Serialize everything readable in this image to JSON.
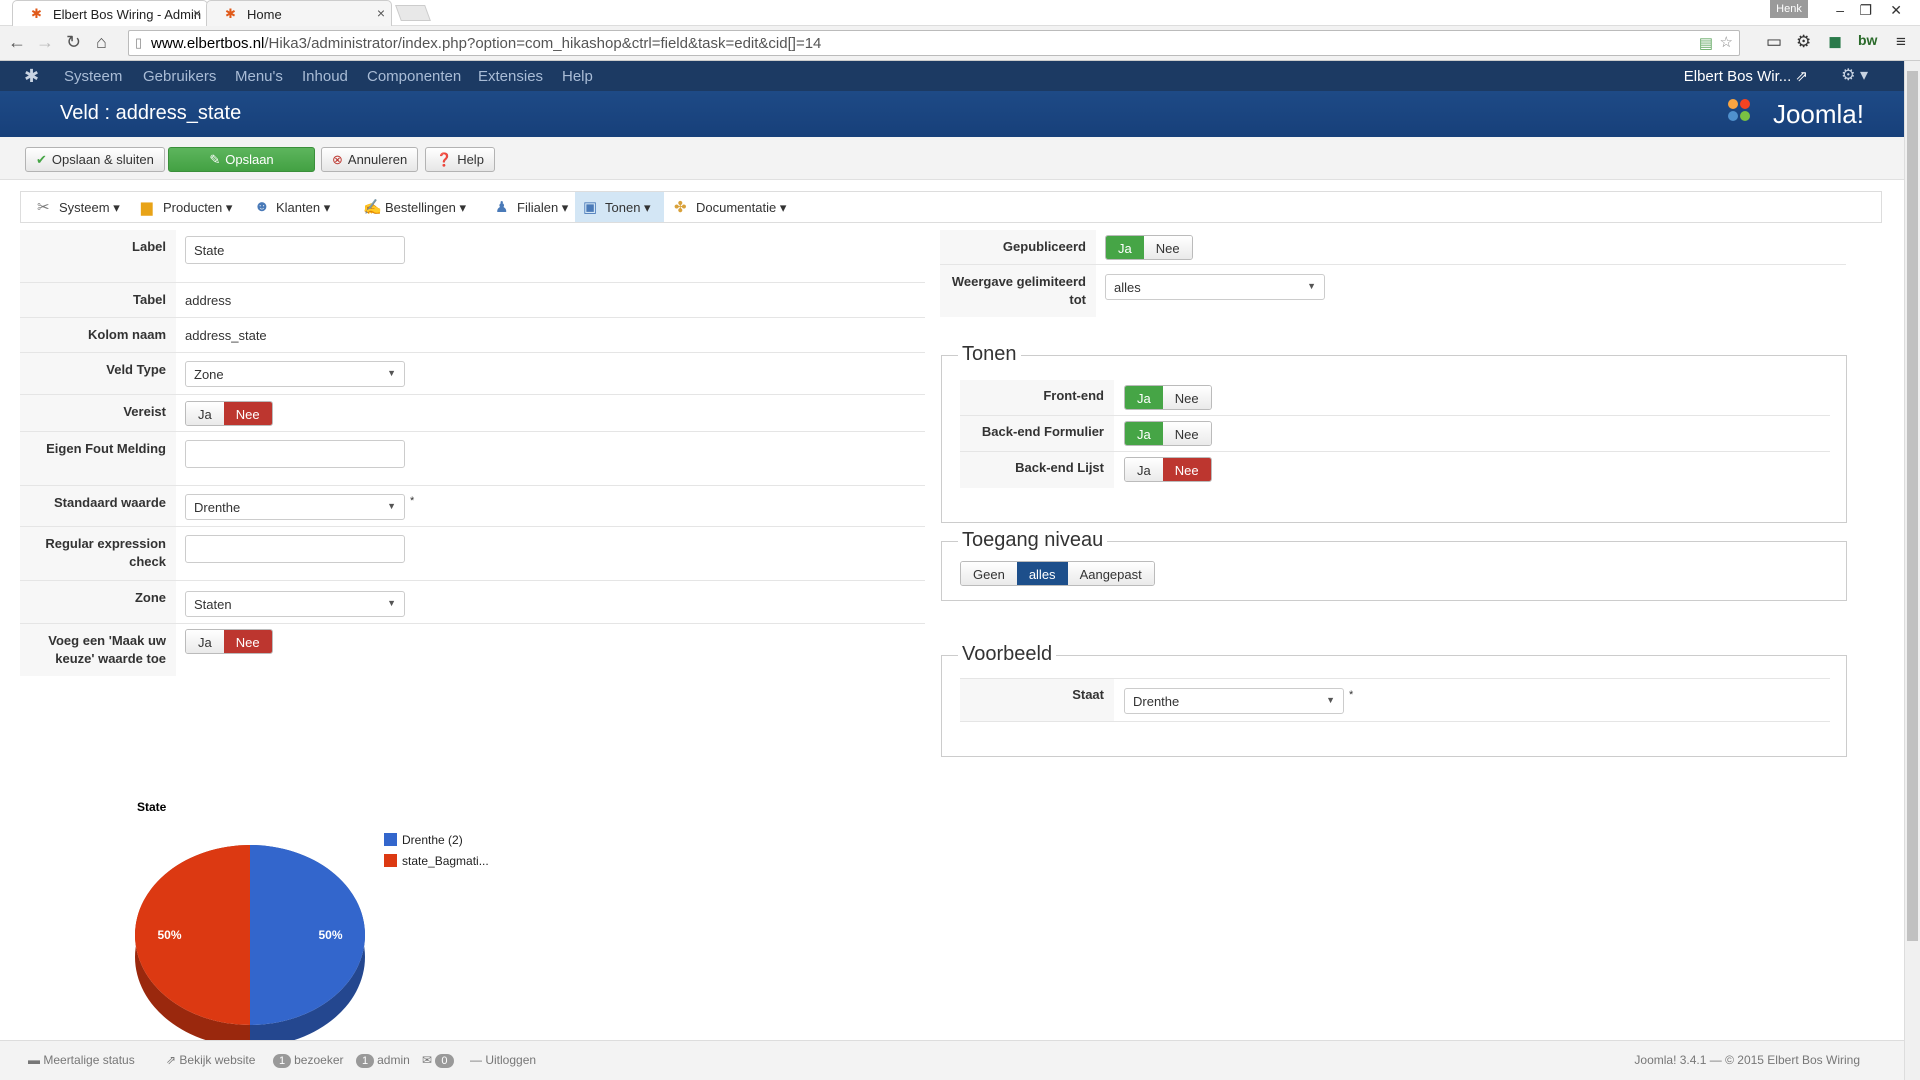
{
  "browser": {
    "tabs": [
      {
        "title": "Elbert Bos Wiring - Admin",
        "close": "×"
      },
      {
        "title": "Home",
        "close": "×"
      }
    ],
    "user": "Henk",
    "url_host": "www.elbertbos.nl",
    "url_path": "/Hika3/administrator/index.php?option=com_hikashop&ctrl=field&task=edit&cid[]=14"
  },
  "topnav": {
    "items": [
      "Systeem",
      "Gebruikers",
      "Menu's",
      "Inhoud",
      "Componenten",
      "Extensies",
      "Help"
    ],
    "site_name": "Elbert Bos Wir... ⇗"
  },
  "header": {
    "title": "Veld : address_state",
    "brand": "Joomla!"
  },
  "toolbar": {
    "save_close": "Opslaan & sluiten",
    "save": "Opslaan",
    "cancel": "Annuleren",
    "help": "Help"
  },
  "submenu": {
    "items": [
      "Systeem",
      "Producten",
      "Klanten",
      "Bestellingen",
      "Filialen",
      "Tonen",
      "Documentatie"
    ],
    "active": "Tonen"
  },
  "form": {
    "label_lbl": "Label",
    "label_val": "State",
    "tabel_lbl": "Tabel",
    "tabel_val": "address",
    "kolom_lbl": "Kolom naam",
    "kolom_val": "address_state",
    "type_lbl": "Veld Type",
    "type_val": "Zone",
    "vereist_lbl": "Vereist",
    "eigen_lbl": "Eigen Fout Melding",
    "eigen_val": "",
    "standaard_lbl": "Standaard waarde",
    "standaard_val": "Drenthe",
    "regex_lbl": "Regular expression check",
    "regex_val": "",
    "zone_lbl": "Zone",
    "zone_val": "Staten",
    "maak_lbl": "Voeg een 'Maak uw keuze' waarde toe",
    "yes": "Ja",
    "no": "Nee",
    "required_mark": "*"
  },
  "right": {
    "gepubliceerd_lbl": "Gepubliceerd",
    "weergave_lbl": "Weergave gelimiteerd tot",
    "weergave_val": "alles",
    "tonen_legend": "Tonen",
    "frontend_lbl": "Front-end",
    "backend_form_lbl": "Back-end Formulier",
    "backend_list_lbl": "Back-end Lijst",
    "toegang_legend": "Toegang niveau",
    "toegang_options": [
      "Geen",
      "alles",
      "Aangepast"
    ],
    "toegang_selected": "alles",
    "voorbeeld_legend": "Voorbeeld",
    "staat_lbl": "Staat",
    "staat_val": "Drenthe"
  },
  "chart_data": {
    "type": "pie",
    "title": "State",
    "categories": [
      "Drenthe (2)",
      "state_Bagmati..."
    ],
    "values": [
      50,
      50
    ],
    "data_labels": [
      "50%",
      "50%"
    ],
    "colors": [
      "#3366cc",
      "#dc3912"
    ],
    "legend_position": "right"
  },
  "statusbar": {
    "multilang": "Meertalige status",
    "view_site": "Bekijk website",
    "visitors_count": "1",
    "visitors": "bezoeker",
    "admin_count": "1",
    "admin": "admin",
    "msg_count": "0",
    "logout": "Uitloggen",
    "copyright": "Joomla! 3.4.1 — © 2015 Elbert Bos Wiring"
  },
  "colors": {
    "topnav": "#1c3a63",
    "header": "#1e4a86",
    "success": "#46a546",
    "danger": "#bd362f"
  }
}
